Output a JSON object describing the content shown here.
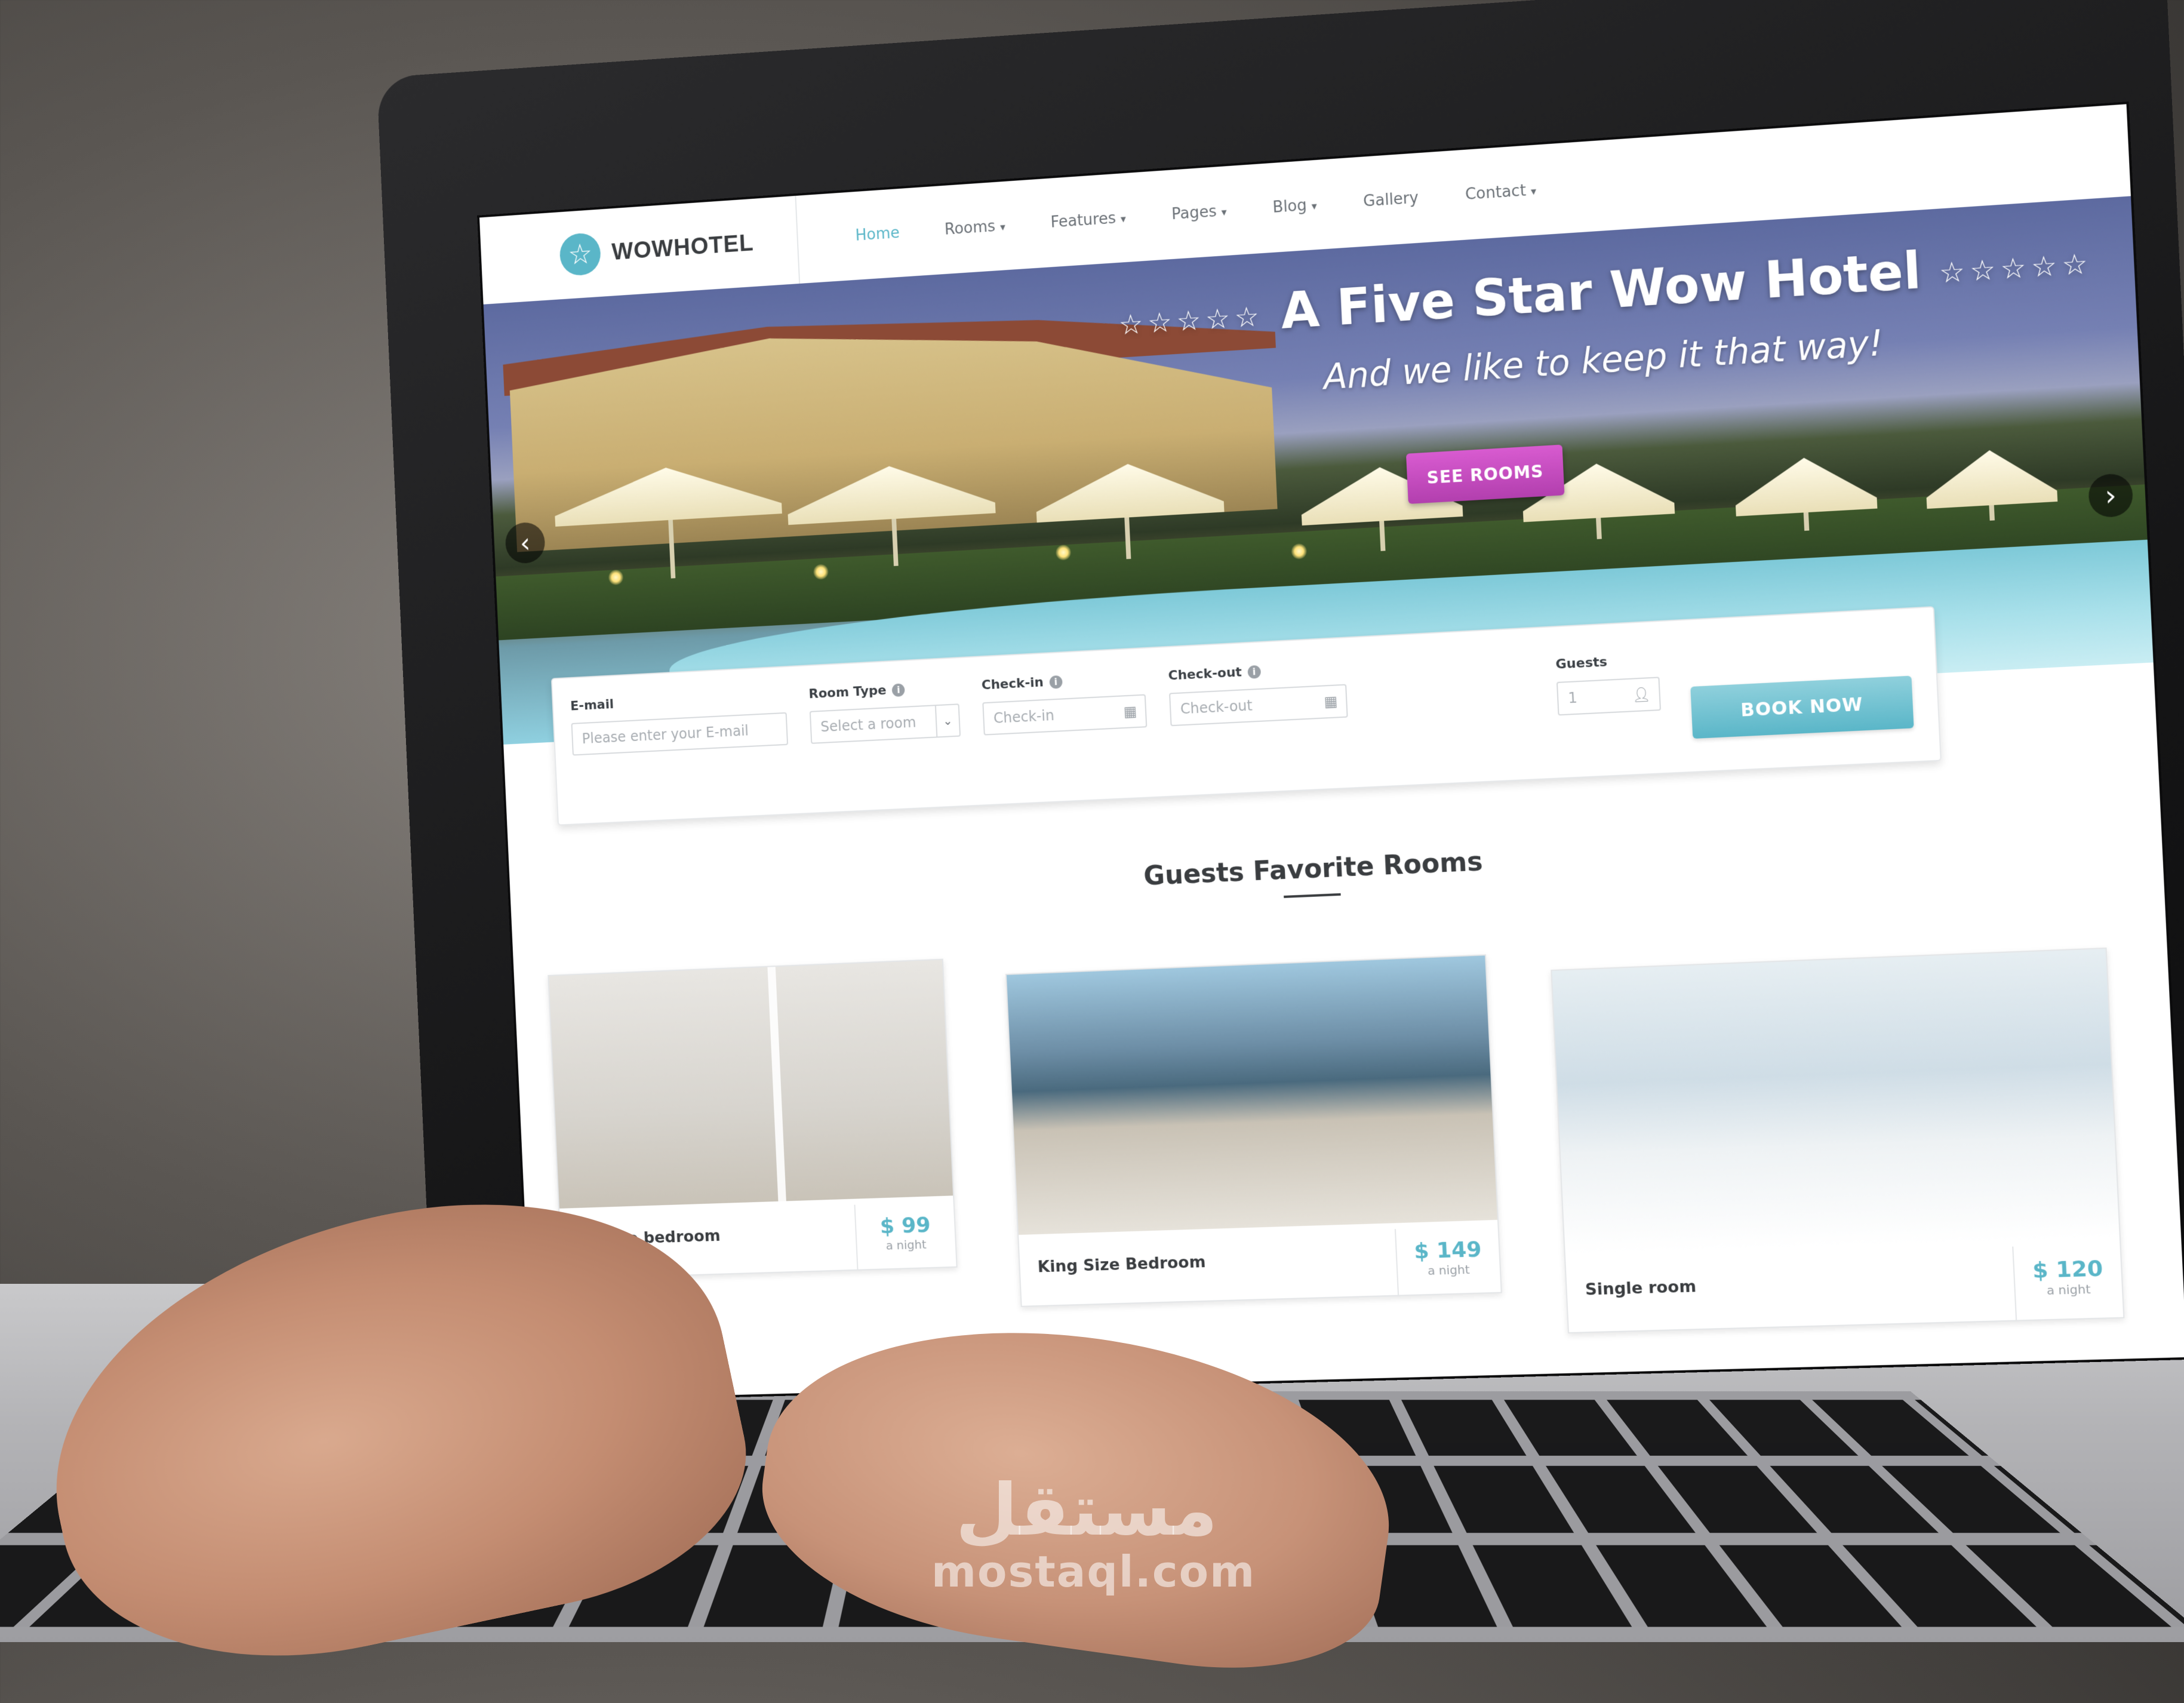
{
  "navbar": {
    "logo_text": "WOWHOTEL",
    "logo_icon": "star-icon",
    "items": [
      {
        "label": "Home",
        "active": true,
        "dropdown": false
      },
      {
        "label": "Rooms",
        "active": false,
        "dropdown": true
      },
      {
        "label": "Features",
        "active": false,
        "dropdown": true
      },
      {
        "label": "Pages",
        "active": false,
        "dropdown": true
      },
      {
        "label": "Blog",
        "active": false,
        "dropdown": true
      },
      {
        "label": "Gallery",
        "active": false,
        "dropdown": false
      },
      {
        "label": "Contact",
        "active": false,
        "dropdown": true
      }
    ]
  },
  "hero": {
    "title": "A Five Star Wow Hotel",
    "stars": "☆☆☆☆☆",
    "subtitle": "And we like to keep it that way!",
    "cta_label": "SEE ROOMS",
    "prev_icon": "chevron-left-icon",
    "next_icon": "chevron-right-icon",
    "prev_glyph": "‹",
    "next_glyph": "›"
  },
  "booking": {
    "email_label": "E-mail",
    "email_placeholder": "Please enter your E-mail",
    "room_type_label": "Room Type",
    "room_type_value": "Select a room",
    "checkin_label": "Check-in",
    "checkin_placeholder": "Check-in",
    "checkout_label": "Check-out",
    "checkout_placeholder": "Check-out",
    "guests_label": "Guests",
    "guests_value": "1",
    "book_label": "BOOK NOW"
  },
  "rooms_section": {
    "title": "Guests Favorite Rooms",
    "rooms": [
      {
        "name": "Double bedroom",
        "price": "$ 99",
        "per": "a night"
      },
      {
        "name": "King Size Bedroom",
        "price": "$ 149",
        "per": "a night"
      },
      {
        "name": "Single room",
        "price": "$ 120",
        "per": "a night"
      }
    ]
  },
  "watermark": {
    "arabic": "مستقل",
    "latin": "mostaql.com"
  },
  "colors": {
    "accent": "#5ab6c8",
    "cta": "#c94ac4",
    "text_dark": "#3a3d40"
  }
}
